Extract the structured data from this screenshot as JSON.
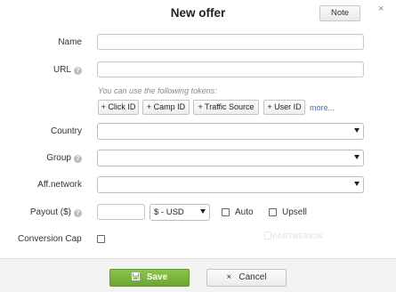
{
  "dialog": {
    "title": "New offer",
    "note_button": "Note",
    "close_glyph": "×"
  },
  "fields": {
    "name": {
      "label": "Name",
      "value": ""
    },
    "url": {
      "label": "URL",
      "value": "",
      "hint": "You can use the following tokens:"
    },
    "tokens": [
      "+ Click ID",
      "+ Camp ID",
      "+ Traffic Source",
      "+ User ID"
    ],
    "more_link": "more...",
    "country": {
      "label": "Country",
      "value": ""
    },
    "group": {
      "label": "Group",
      "value": ""
    },
    "aff_network": {
      "label": "Aff.network",
      "value": ""
    },
    "payout": {
      "label": "Payout ($)",
      "value": "",
      "currency": "$ - USD"
    },
    "auto_label": "Auto",
    "upsell_label": "Upsell",
    "conversion_cap": {
      "label": "Conversion Cap"
    }
  },
  "help_glyph": "?",
  "watermark": "PARTNERKIN",
  "footer": {
    "save_label": "Save",
    "cancel_label": "Cancel"
  },
  "colors": {
    "save_green": "#7ab83e",
    "link_blue": "#3a6fb5"
  },
  "icons": {
    "help": "question-circle-icon",
    "save": "floppy-disk-icon",
    "cancel": "close-icon",
    "select": "caret-down-icon"
  }
}
